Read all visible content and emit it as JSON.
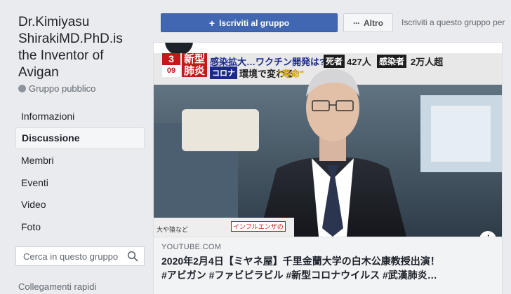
{
  "group": {
    "title_lines": [
      "Dr.Kimiyasu",
      "ShirakiMD.PhD.is",
      "the Inventor of",
      "Avigan"
    ],
    "type": "Gruppo pubblico"
  },
  "nav": [
    {
      "label": "Informazioni",
      "active": false
    },
    {
      "label": "Discussione",
      "active": true
    },
    {
      "label": "Membri",
      "active": false
    },
    {
      "label": "Eventi",
      "active": false
    },
    {
      "label": "Video",
      "active": false
    },
    {
      "label": "Foto",
      "active": false
    }
  ],
  "search": {
    "placeholder": "Cerca in questo gruppo"
  },
  "shortcuts_label": "Collegamenti rapidi",
  "topbar": {
    "join_label": "Iscriviti al gruppo",
    "more_label": "Altro",
    "subscribe_text": "Iscriviti a questo gruppo per"
  },
  "video": {
    "channel_number": "3",
    "channel_sub": "09",
    "tag_new": "新型",
    "tag_pneumonia": "肺炎",
    "banner_top": "感染拡大…ワクチン開発は?",
    "banner_corona": "コロナ",
    "banner_env": "環境で変わる",
    "banner_fate": "\"寿命\"",
    "deaths_label": "死者",
    "deaths_value": "427人",
    "infected_label": "感染者",
    "infected_value": "2万人超",
    "lower_text": "大や猿など",
    "flu_text": "インフルエンザの"
  },
  "post": {
    "domain": "YOUTUBE.COM",
    "headline_1": "2020年2月4日【ミヤネ屋】千里金蘭大学の白木公康教授出演！",
    "headline_2": "#アビガン #ファビピラビル #新型コロナウイルス #武漢肺炎…"
  },
  "colors": {
    "brand": "#4267b2",
    "background": "#e9ebee",
    "text": "#1d2129"
  }
}
